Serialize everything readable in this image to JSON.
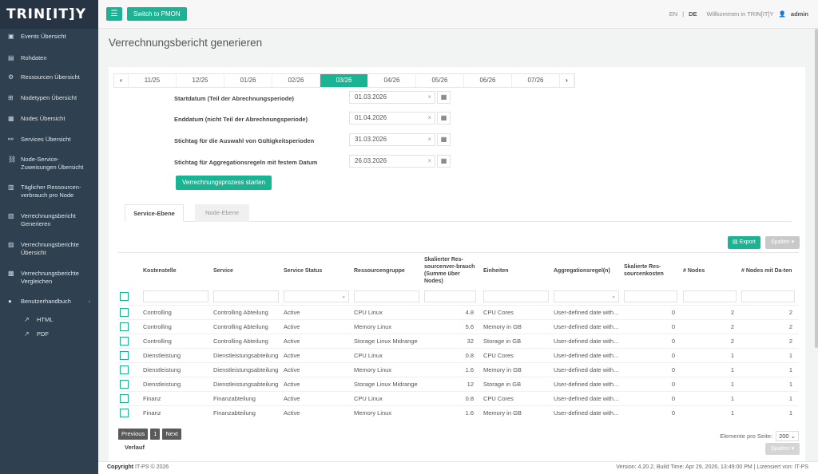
{
  "sidebar": {
    "logo": "TRIN[IT]Y",
    "items": [
      {
        "icon": "calendar-icon",
        "label": "Events Übersicht"
      },
      {
        "icon": "file-icon",
        "label": "Rohdaten"
      },
      {
        "icon": "gear-icon",
        "label": "Ressourcen Übersicht"
      },
      {
        "icon": "nodes-icon",
        "label": "Nodetypen Übersicht"
      },
      {
        "icon": "node-icon",
        "label": "Nodes Übersicht"
      },
      {
        "icon": "service-icon",
        "label": "Services Übersicht"
      },
      {
        "icon": "link-icon",
        "label": "Node-Service-Zuweisungen Übersicht"
      },
      {
        "icon": "bar-icon",
        "label": "Täglicher Ressourcen-verbrauch pro Node"
      },
      {
        "icon": "report-icon",
        "label": "Verrechnungsbericht Generieren"
      },
      {
        "icon": "report-list-icon",
        "label": "Verrechnungsberichte Übersicht"
      },
      {
        "icon": "compare-icon",
        "label": "Verrechnungsberichte Vergleichen"
      },
      {
        "icon": "help-icon",
        "label": "Benutzerhandbuch"
      }
    ],
    "subitems": [
      {
        "icon": "external-link-icon",
        "label": "HTML"
      },
      {
        "icon": "external-link-icon",
        "label": "PDF"
      }
    ]
  },
  "topbar": {
    "switch_label": "Switch to PMON",
    "lang_en": "EN",
    "lang_sep": "|",
    "lang_de": "DE",
    "welcome": "Willkommen in TRIN[IT]Y",
    "user": "admin"
  },
  "page": {
    "title": "Verrechnungsbericht generieren"
  },
  "periods": [
    "11/25",
    "12/25",
    "01/26",
    "02/26",
    "03/26",
    "04/26",
    "05/26",
    "06/26",
    "07/26"
  ],
  "active_period": "03/26",
  "form": {
    "fields": [
      {
        "label": "Startdatum (Teil der Abrechnungsperiode)",
        "value": "01.03.2026"
      },
      {
        "label": "Enddatum (nicht Teil der Abrechnungsperiode)",
        "value": "01.04.2026"
      },
      {
        "label": "Stichtag für die Auswahl von Gültigkeitsperioden",
        "value": "31.03.2026"
      },
      {
        "label": "Stichtag für Aggregationsregeln mit festem Datum",
        "value": "26.03.2026"
      }
    ],
    "start_button": "Verrechnungsprozess starten"
  },
  "tabs": [
    "Service-Ebene",
    "Node-Ebene"
  ],
  "toolbar": {
    "export": "Export",
    "columns": "Spalten"
  },
  "table": {
    "headers": [
      "Kostenstelle",
      "Service",
      "Service Status",
      "Ressourcengruppe",
      "Skalierter Res-sourcenver-brauch (Summe über Nodes)",
      "Einheiten",
      "Aggregationsregel(n)",
      "Skalierte Res-sourcenkosten",
      "# Nodes",
      "# Nodes mit Da-ten"
    ],
    "rows": [
      [
        "Controlling",
        "Controlling Abteilung",
        "Active",
        "CPU Linux",
        "4.8",
        "CPU Cores",
        "User-defined date with...",
        "0",
        "2",
        "2"
      ],
      [
        "Controlling",
        "Controlling Abteilung",
        "Active",
        "Memory Linux",
        "5.6",
        "Memory in GB",
        "User-defined date with...",
        "0",
        "2",
        "2"
      ],
      [
        "Controlling",
        "Controlling Abteilung",
        "Active",
        "Storage Linux Midrange",
        "32",
        "Storage in GB",
        "User-defined date with...",
        "0",
        "2",
        "2"
      ],
      [
        "Dienstleistung",
        "Dienstleistungsabteilung",
        "Active",
        "CPU Linux",
        "0.8",
        "CPU Cores",
        "User-defined date with...",
        "0",
        "1",
        "1"
      ],
      [
        "Dienstleistung",
        "Dienstleistungsabteilung",
        "Active",
        "Memory Linux",
        "1.6",
        "Memory in GB",
        "User-defined date with...",
        "0",
        "1",
        "1"
      ],
      [
        "Dienstleistung",
        "Dienstleistungsabteilung",
        "Active",
        "Storage Linux Midrange",
        "12",
        "Storage in GB",
        "User-defined date with...",
        "0",
        "1",
        "1"
      ],
      [
        "Finanz",
        "Finanzabteilung",
        "Active",
        "CPU Linux",
        "0.8",
        "CPU Cores",
        "User-defined date with...",
        "0",
        "1",
        "1"
      ],
      [
        "Finanz",
        "Finanzabteilung",
        "Active",
        "Memory Linux",
        "1.6",
        "Memory in GB",
        "User-defined date with...",
        "0",
        "1",
        "1"
      ]
    ]
  },
  "pager": {
    "previous": "Previous",
    "page": "1",
    "next": "Next"
  },
  "per_page": {
    "label": "Elemente pro Seite:",
    "value": "200"
  },
  "history": "Verlauf",
  "footer": {
    "copyright_b": "Copyright",
    "copyright": "IT-PS © 2026",
    "version": "Version: 4.20.2, Build Time: Apr 29, 2026, 13:49:00 PM | Lizensiert von: IT-PS"
  },
  "colors": {
    "accent": "#1ab394",
    "sidebar": "#2f4050"
  }
}
